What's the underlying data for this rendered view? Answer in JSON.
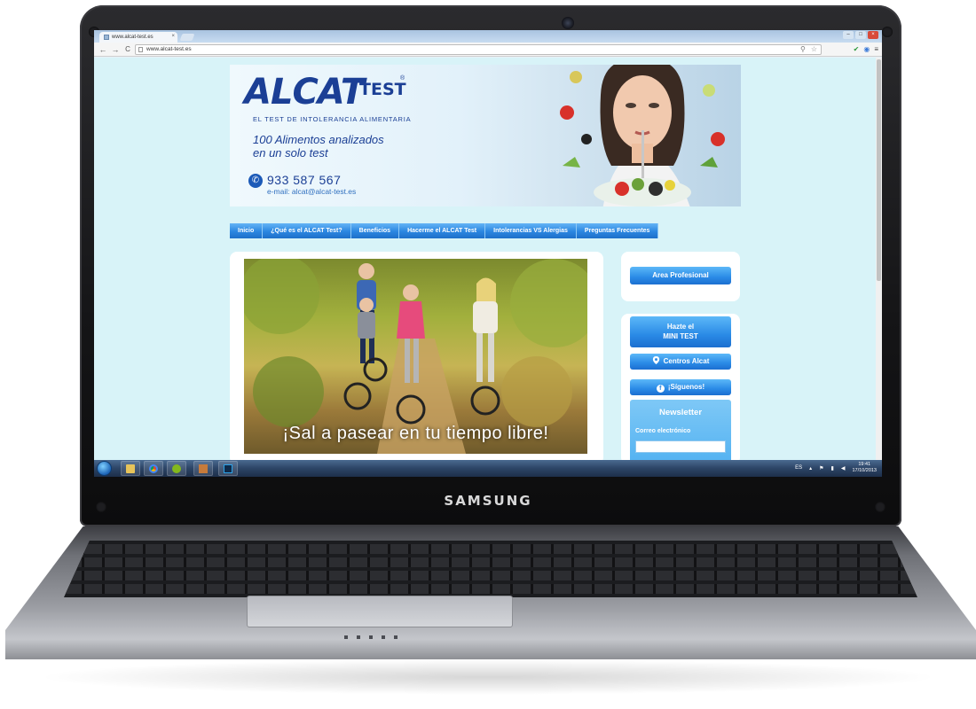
{
  "laptop": {
    "brand": "SAMSUNG"
  },
  "browser": {
    "tab_title": "www.alcat-test.es",
    "tab_close": "×",
    "url": "www.alcat-test.es",
    "back_icon": "←",
    "forward_icon": "→",
    "reload_icon": "C",
    "zoom_icon": "⚲",
    "star_icon": "☆",
    "menu_icon": "≡",
    "window_controls": {
      "minimize": "–",
      "maximize": "□",
      "close": "×"
    }
  },
  "site": {
    "logo": {
      "alcat": "ALCAT",
      "test": "TEST",
      "reg": "®",
      "subtitle": "EL TEST DE INTOLERANCIA ALIMENTARIA"
    },
    "tagline_line1": "100 Alimentos analizados",
    "tagline_line2": "en un solo test",
    "phone": "933 587 567",
    "email": "e-mail: alcat@alcat-test.es",
    "nav": [
      {
        "label": "Inicio"
      },
      {
        "label": "¿Qué es el ALCAT Test?"
      },
      {
        "label": "Beneficios"
      },
      {
        "label": "Hacerme el ALCAT Test"
      },
      {
        "label": "Intolerancias VS Alergias"
      },
      {
        "label": "Preguntas Frecuentes"
      }
    ],
    "slide_caption": "¡Sal a pasear en tu tiempo libre!",
    "sidebar": {
      "area_profesional": "Area Profesional",
      "mini_test_line1": "Hazte el",
      "mini_test_line2": "MINI TEST",
      "centros": "Centros Alcat",
      "siguenos": "¡Síguenos!",
      "newsletter_title": "Newsletter",
      "newsletter_label": "Correo electrónico",
      "newsletter_input_value": ""
    }
  },
  "taskbar": {
    "language": "ES",
    "time": "19:41",
    "date": "17/10/2013"
  },
  "colors": {
    "page_bg": "#d8f3f8",
    "nav_blue": "#2b86e0",
    "brand_blue": "#1b3f95"
  }
}
